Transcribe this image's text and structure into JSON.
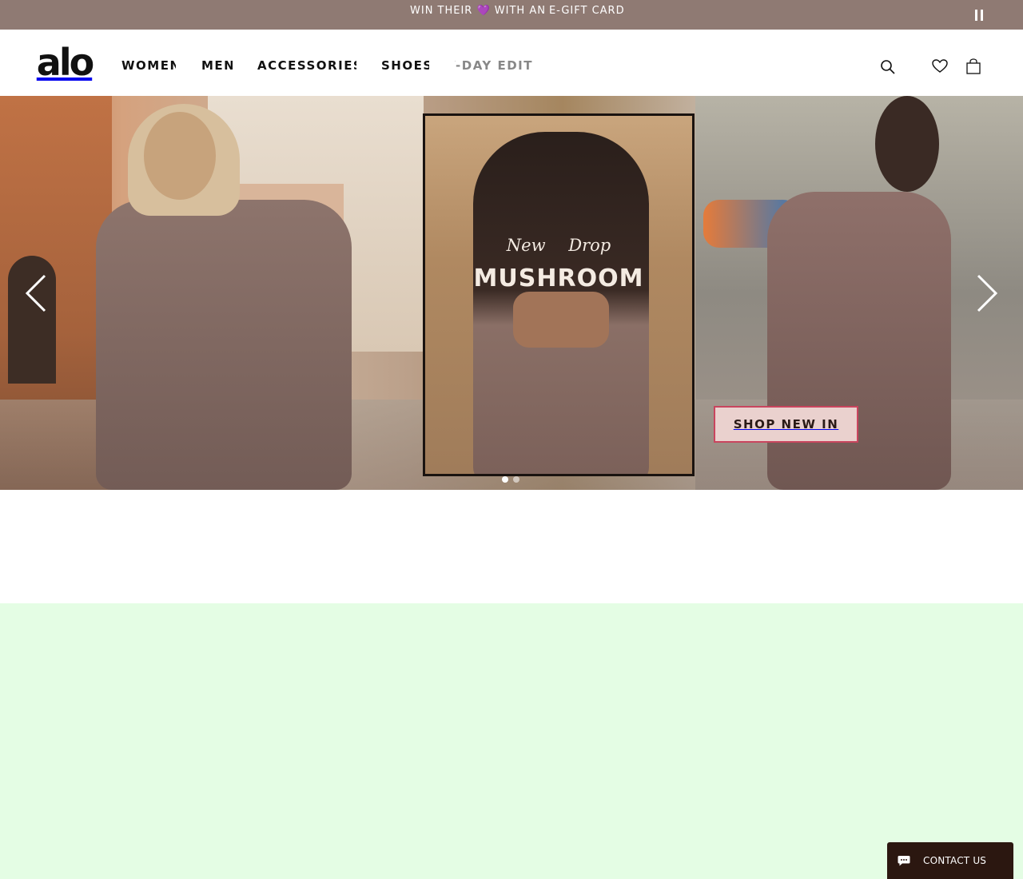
{
  "announcement": {
    "text": "WIN THEIR 💜 WITH AN",
    "link": "E-GIFT CARD"
  },
  "header": {
    "logo": "alo",
    "nav": [
      {
        "label": "WOMEN"
      },
      {
        "label": "MEN"
      },
      {
        "label": "ACCESSORIES"
      },
      {
        "label": "SHOES"
      },
      {
        "label": "V-DAY EDIT"
      }
    ]
  },
  "icons": {
    "search": "search-icon",
    "wishlist": "heart-icon",
    "bag": "bag-icon",
    "pause": "pause-icon"
  },
  "hero": {
    "poster_small": "New Drop",
    "poster_main": "MUSHROOM",
    "cta": "SHOP NEW IN",
    "slides": 2,
    "active_slide": 1
  },
  "contact": {
    "label": "CONTACT US"
  },
  "colors": {
    "announcement_bg": "#8f7a73",
    "cta_bg": "#ead1ce",
    "contact_bg": "#2b1710"
  }
}
